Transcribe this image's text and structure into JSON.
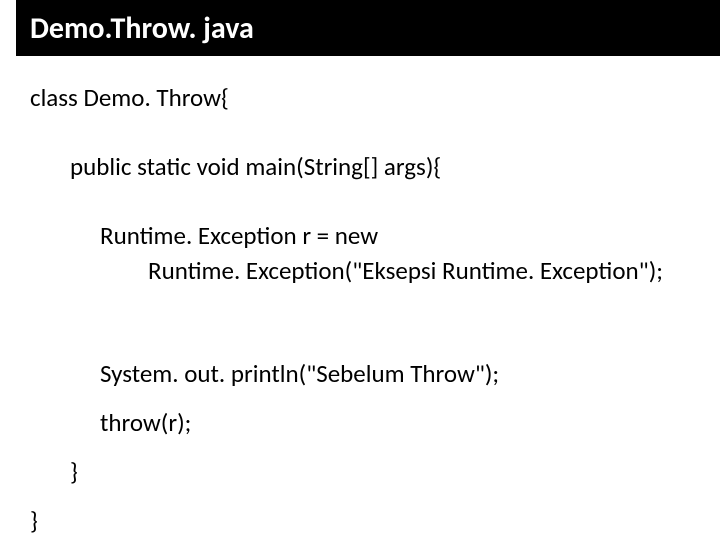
{
  "title": "Demo.Throw. java",
  "code": {
    "l1": "class Demo. Throw{",
    "l2": "public static void main(String[] args){",
    "l3": "Runtime. Exception r = new",
    "l4": "Runtime. Exception(\"Eksepsi Runtime. Exception\");",
    "l5": "System. out. println(\"Sebelum Throw\");",
    "l6": "throw(r);",
    "l7": "}",
    "l8": "}"
  }
}
